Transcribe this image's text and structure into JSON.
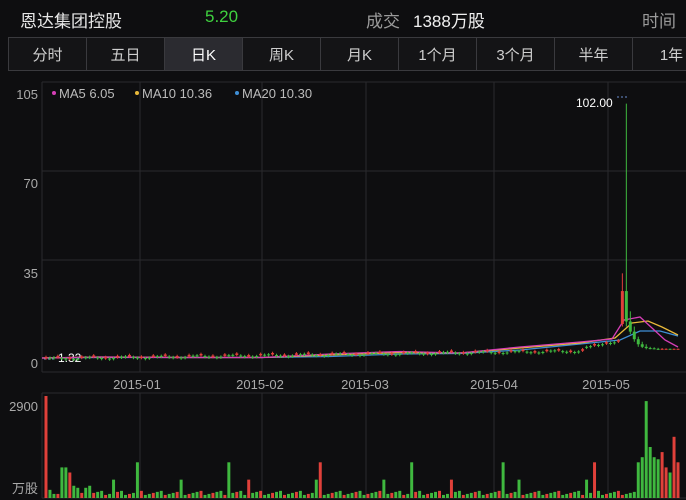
{
  "header": {
    "stock_name": "恩达集团控股",
    "price": "5.20",
    "volume_label": "成交",
    "volume_value": "1388万股",
    "time_label": "时间"
  },
  "tabs": [
    {
      "label": "分时"
    },
    {
      "label": "五日"
    },
    {
      "label": "日K",
      "active": true
    },
    {
      "label": "周K"
    },
    {
      "label": "月K"
    },
    {
      "label": "1个月"
    },
    {
      "label": "3个月"
    },
    {
      "label": "半年"
    },
    {
      "label": "1年"
    }
  ],
  "chart_data": {
    "type": "line",
    "y_ticks": [
      "105",
      "70",
      "35",
      "0"
    ],
    "y_range": [
      0,
      105
    ],
    "x_ticks": [
      "2015-01",
      "2015-02",
      "2015-03",
      "2015-04",
      "2015-05"
    ],
    "legend": [
      {
        "label": "MA5 6.05",
        "color": "#d63fb7"
      },
      {
        "label": "MA10 10.36",
        "color": "#e8b93a"
      },
      {
        "label": "MA20 10.30",
        "color": "#3f8fd6"
      }
    ],
    "annotations": {
      "high": "102.00",
      "low": "1.32"
    },
    "volume": {
      "y_tick": "2900",
      "unit_label": "万股"
    },
    "colors": {
      "up": "#e0403a",
      "down": "#3fb83f",
      "grid": "#2a2a2e"
    }
  }
}
